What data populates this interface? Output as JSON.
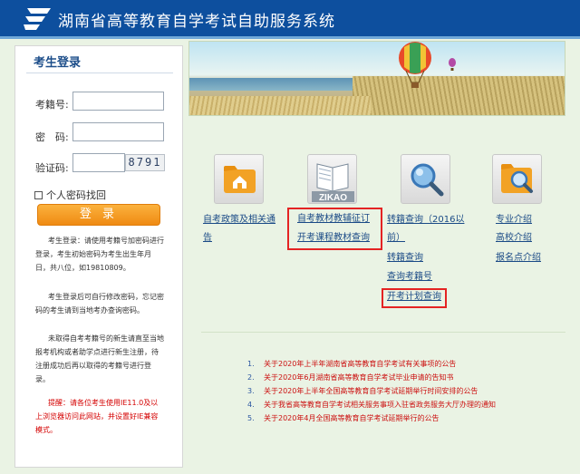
{
  "header": {
    "title": "湖南省高等教育自学考试自助服务系统"
  },
  "login": {
    "title": "考生登录",
    "exam_no_label": "考籍号:",
    "password_label": "密　码:",
    "captcha_label": "验证码:",
    "captcha_value": "8791",
    "remember_label": "个人密码找回",
    "button_label": "登 录",
    "notes": [
      "考生登录：请使用考籍号加密码进行登录，考生初始密码为考生出生年月日，共八位，如19810809。",
      "考生登录后可自行修改密码，忘记密码的考生请到当地考办查询密码。",
      "未取得自考考籍号的新生请直至当地报考机构或者助学点进行新生注册，待注册成功后再以取得的考籍号进行登录。",
      "提醒：请各位考生使用IE11.0及以上浏览器访问此网站，并设置好IE兼容模式。"
    ]
  },
  "services": {
    "col1": [
      "自考政策及相关通",
      "告"
    ],
    "col2": [
      "自考教材教辅征订",
      "开考课程教材查询"
    ],
    "col3": [
      "转籍查询（2016以",
      "前）",
      "转籍查询",
      "查询考籍号",
      "开考计划查询"
    ],
    "col4": [
      "专业介绍",
      "高校介绍",
      "报名点介绍"
    ],
    "zikao_label": "ZIKAO"
  },
  "news": [
    {
      "num": "1.",
      "text": "关于2020年上半年湖南省高等教育自学考试有关事项的公告"
    },
    {
      "num": "2.",
      "text": "关于2020年6月湖南省高等教育自学考试毕业申请的告知书"
    },
    {
      "num": "3.",
      "text": "关于2020年上半年全国高等教育自学考试延期举行时间安排的公告"
    },
    {
      "num": "4.",
      "text": "关于我省高等教育自学考试相关服务事项入驻省政务服务大厅办理的通知"
    },
    {
      "num": "5.",
      "text": "关于2020年4月全国高等教育自学考试延期举行的公告"
    }
  ],
  "colors": {
    "header": "#0d4f9e",
    "accent": "#ef8a12",
    "link": "#1a4a86",
    "news": "#cc1111",
    "highlight": "#e42323"
  }
}
